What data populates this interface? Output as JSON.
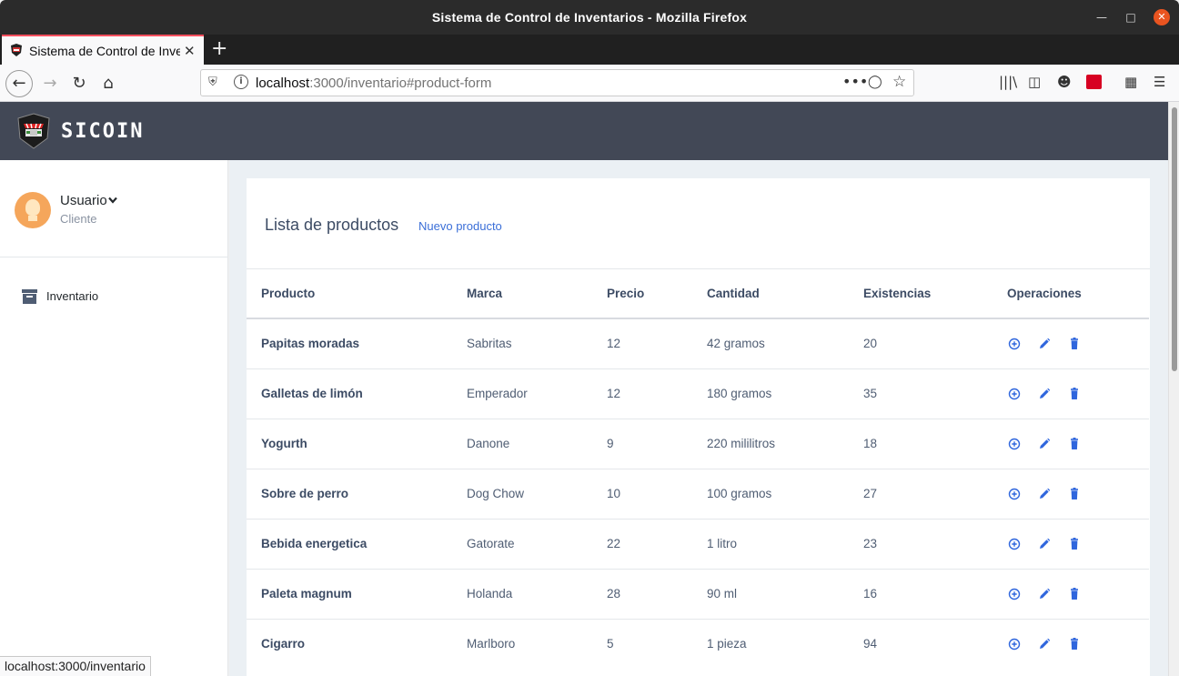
{
  "window": {
    "title": "Sistema de Control de Inventarios - Mozilla Firefox"
  },
  "tab": {
    "title": "Sistema de Control de Inventarios"
  },
  "urlbar": {
    "host": "localhost",
    "path": ":3000/inventario#product-form"
  },
  "app": {
    "brand": "SICOIN"
  },
  "user": {
    "name": "Usuario",
    "role": "Cliente"
  },
  "sidebar": {
    "items": [
      {
        "label": "Inventario"
      }
    ]
  },
  "card": {
    "title": "Lista de productos",
    "new_link": "Nuevo producto"
  },
  "table": {
    "headers": [
      "Producto",
      "Marca",
      "Precio",
      "Cantidad",
      "Existencias",
      "Operaciones"
    ],
    "rows": [
      {
        "producto": "Papitas moradas",
        "marca": "Sabritas",
        "precio": "12",
        "cantidad": "42 gramos",
        "existencias": "20"
      },
      {
        "producto": "Galletas de limón",
        "marca": "Emperador",
        "precio": "12",
        "cantidad": "180 gramos",
        "existencias": "35"
      },
      {
        "producto": "Yogurth",
        "marca": "Danone",
        "precio": "9",
        "cantidad": "220 mililitros",
        "existencias": "18"
      },
      {
        "producto": "Sobre de perro",
        "marca": "Dog Chow",
        "precio": "10",
        "cantidad": "100 gramos",
        "existencias": "27"
      },
      {
        "producto": "Bebida energetica",
        "marca": "Gatorate",
        "precio": "22",
        "cantidad": "1 litro",
        "existencias": "23"
      },
      {
        "producto": "Paleta magnum",
        "marca": "Holanda",
        "precio": "28",
        "cantidad": "90 ml",
        "existencias": "16"
      },
      {
        "producto": "Cigarro",
        "marca": "Marlboro",
        "precio": "5",
        "cantidad": "1 pieza",
        "existencias": "94"
      }
    ]
  },
  "statusbar": {
    "text": "localhost:3000/inventario"
  },
  "colors": {
    "header_bg": "#424856",
    "link": "#3b6fd8",
    "op_icon": "#2f66dd",
    "tab_accent": "#ff4f5e",
    "close_btn": "#e95420"
  },
  "icons": [
    "add-circle-icon",
    "pencil-icon",
    "trash-icon",
    "archive-box-icon",
    "chevron-down-icon"
  ]
}
